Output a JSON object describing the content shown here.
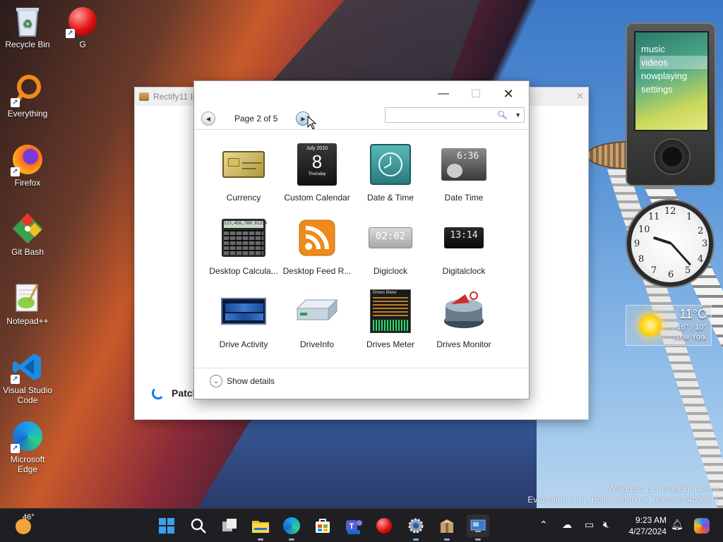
{
  "desktop": {
    "icons": [
      {
        "label": "Recycle Bin"
      },
      {
        "label": "G"
      },
      {
        "label": "Everything"
      },
      {
        "label": "Firefox"
      },
      {
        "label": "Git Bash"
      },
      {
        "label": "Notepad++"
      },
      {
        "label": "Visual Studio Code"
      },
      {
        "label": "Microsoft Edge"
      }
    ],
    "watermark": {
      "line1": "Windows 11 Pro Insider Previ",
      "line2": "Evaluation copy. Build 26080.ge_release.240308-1"
    }
  },
  "background_window": {
    "title": "Rectify11 In",
    "status_text": "Patcl"
  },
  "gadget_dialog": {
    "pager_label": "Page 2 of 5",
    "search_placeholder": "",
    "gadgets": [
      {
        "name": "Currency",
        "icon": "currency-icon"
      },
      {
        "name": "Custom Calendar",
        "icon": "calendar-icon",
        "cal_month": "July 2010",
        "cal_day": "8",
        "cal_weekday": "Thursday"
      },
      {
        "name": "Date & Time",
        "icon": "clock-icon"
      },
      {
        "name": "Date Time",
        "icon": "datetime-icon",
        "digits": "6:36"
      },
      {
        "name": "Desktop Calcula...",
        "icon": "calculator-icon",
        "display": "123,456,789.01234"
      },
      {
        "name": "Desktop Feed R...",
        "icon": "rss-icon"
      },
      {
        "name": "Digiclock",
        "icon": "digiclock-icon",
        "digits": "02:02"
      },
      {
        "name": "Digitalclock",
        "icon": "digitalclock-icon",
        "digits": "13:14"
      },
      {
        "name": "Drive Activity",
        "icon": "drive-activity-icon"
      },
      {
        "name": "DriveInfo",
        "icon": "drive-icon"
      },
      {
        "name": "Drives Meter",
        "icon": "drives-meter-icon",
        "header": "Drives Meter"
      },
      {
        "name": "Drives Monitor",
        "icon": "drives-monitor-icon"
      }
    ],
    "show_details_label": "Show details"
  },
  "zune_gadget": {
    "menu": [
      {
        "label": "music",
        "selected": false
      },
      {
        "label": "videos",
        "selected": true
      },
      {
        "label": "nowplaying",
        "selected": false
      },
      {
        "label": "settings",
        "selected": false
      }
    ]
  },
  "clock_gadget": {
    "numbers": [
      "12",
      "1",
      "2",
      "3",
      "4",
      "5",
      "6",
      "7",
      "8",
      "9",
      "10",
      "11"
    ]
  },
  "weather_gadget": {
    "temperature": "11°C",
    "range": "16° / 10°",
    "city": "New York"
  },
  "taskbar": {
    "weather_temp": "46°",
    "time": "9:23 AM",
    "date": "4/27/2024",
    "apps": [
      {
        "name": "start-button"
      },
      {
        "name": "search-button"
      },
      {
        "name": "task-view-button"
      },
      {
        "name": "file-explorer-button"
      },
      {
        "name": "edge-button"
      },
      {
        "name": "store-button"
      },
      {
        "name": "teams-button"
      },
      {
        "name": "red-ball-app-button"
      },
      {
        "name": "settings-button"
      },
      {
        "name": "installer-button"
      },
      {
        "name": "gadgets-button"
      }
    ]
  }
}
